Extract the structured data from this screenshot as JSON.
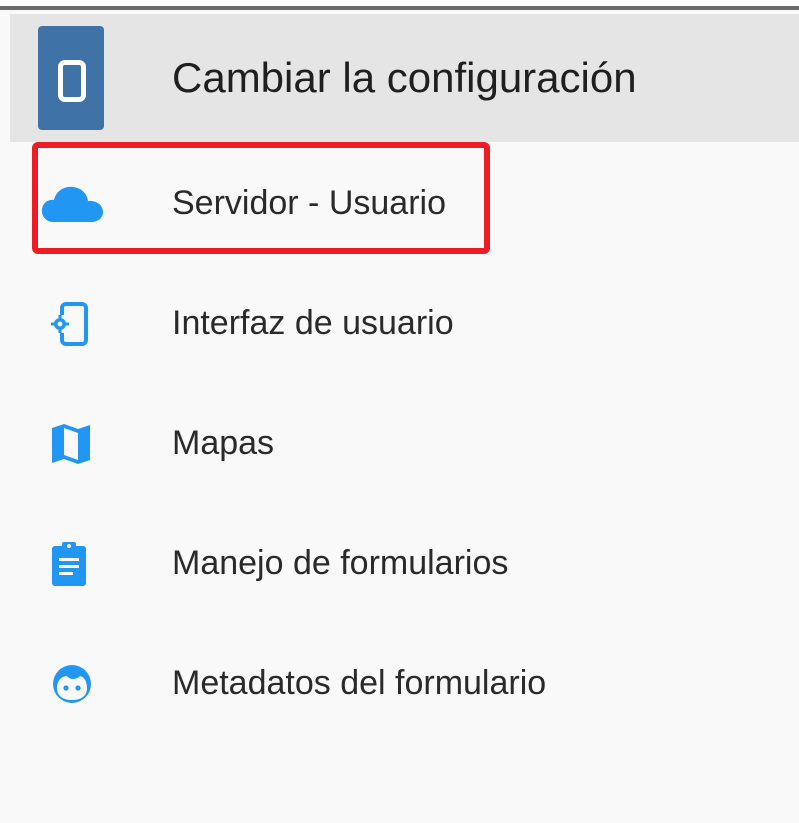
{
  "header": {
    "title": "Cambiar la configuración",
    "app_icon": "device-settings-app-icon"
  },
  "menu": {
    "items": [
      {
        "label": "Servidor - Usuario",
        "icon": "cloud-icon"
      },
      {
        "label": "Interfaz de usuario",
        "icon": "phone-settings-icon"
      },
      {
        "label": "Mapas",
        "icon": "map-icon"
      },
      {
        "label": "Manejo de formularios",
        "icon": "clipboard-icon"
      },
      {
        "label": "Metadatos del formulario",
        "icon": "face-icon"
      }
    ]
  },
  "colors": {
    "accent": "#2196f3",
    "header_bg": "#e5e5e5",
    "app_icon_bg": "#3f72a6",
    "highlight": "#ee1c24",
    "page_bg": "#f9f9f9"
  }
}
